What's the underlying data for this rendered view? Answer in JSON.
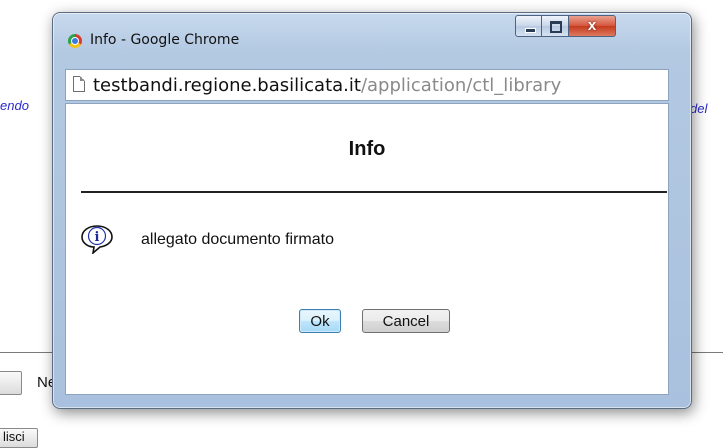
{
  "background": {
    "left_fragment": "endo",
    "right_fragment": "del",
    "ne_fragment": "Ne",
    "bottom_button": "lisci"
  },
  "window": {
    "title": "Info - Google Chrome",
    "controls": {
      "minimize": "minimize",
      "maximize": "maximize",
      "close": "x"
    },
    "url_host": "testbandi.regione.basilicata.it",
    "url_path": "/application/ctl_library"
  },
  "dialog": {
    "title": "Info",
    "message": "allegato documento firmato",
    "ok_label": "Ok",
    "cancel_label": "Cancel"
  },
  "icons": {
    "browser": "chrome-icon",
    "page": "page-icon",
    "info": "info-speech-bubble-icon"
  }
}
